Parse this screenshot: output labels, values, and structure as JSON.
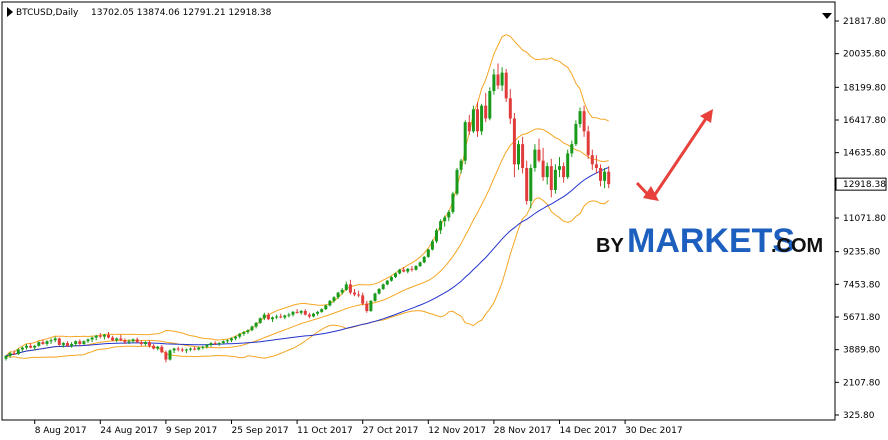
{
  "header": {
    "symbol": "BTCUSD,Daily",
    "ohlc": "13702.05 13874.06 12791.21 12918.38"
  },
  "brand": {
    "by": "BY",
    "main": "MARKETS",
    "com": ".COM"
  },
  "colors": {
    "background": "#ffffff",
    "candle_up": "#1a9a1a",
    "candle_down": "#e03c3c",
    "bollinger": "#f5a623",
    "ma": "#2233cc",
    "arrow": "#e8403a",
    "price_tag_bg": "#ffffff",
    "brand_blue": "#1d5fbf"
  },
  "chart_data": {
    "type": "candlestick",
    "title": "BTCUSD,Daily",
    "y_ticks": [
      "21817.80",
      "20035.80",
      "18199.80",
      "16417.80",
      "14635.80",
      "12918.38",
      "11071.80",
      "9235.80",
      "7453.80",
      "5671.80",
      "3889.80",
      "2107.80",
      "325.80"
    ],
    "x_ticks": [
      "8 Aug 2017",
      "24 Aug 2017",
      "9 Sep 2017",
      "25 Sep 2017",
      "11 Oct 2017",
      "27 Oct 2017",
      "12 Nov 2017",
      "28 Nov 2017",
      "14 Dec 2017",
      "30 Dec 2017"
    ],
    "ylim": [
      325.8,
      22500
    ],
    "current_price": "12918.38",
    "start_date": "2017-08-01",
    "candles": [
      [
        3400,
        3600,
        3300,
        3550
      ],
      [
        3550,
        3750,
        3450,
        3700
      ],
      [
        3700,
        3850,
        3600,
        3650
      ],
      [
        3650,
        3950,
        3600,
        3900
      ],
      [
        3900,
        4050,
        3800,
        4000
      ],
      [
        4000,
        4200,
        3900,
        4100
      ],
      [
        4100,
        4250,
        3950,
        4000
      ],
      [
        4000,
        4150,
        3850,
        4100
      ],
      [
        4100,
        4350,
        4050,
        4300
      ],
      [
        4300,
        4450,
        4150,
        4200
      ],
      [
        4200,
        4400,
        4100,
        4350
      ],
      [
        4350,
        4500,
        4200,
        4400
      ],
      [
        4400,
        4600,
        4300,
        4500
      ],
      [
        4500,
        4550,
        4100,
        4150
      ],
      [
        4150,
        4300,
        4000,
        4250
      ],
      [
        4250,
        4350,
        4050,
        4100
      ],
      [
        4100,
        4300,
        4000,
        4200
      ],
      [
        4200,
        4400,
        4100,
        4350
      ],
      [
        4350,
        4450,
        4150,
        4200
      ],
      [
        4200,
        4400,
        4150,
        4350
      ],
      [
        4350,
        4500,
        4250,
        4450
      ],
      [
        4450,
        4600,
        4300,
        4550
      ],
      [
        4550,
        4700,
        4400,
        4650
      ],
      [
        4650,
        4800,
        4500,
        4600
      ],
      [
        4600,
        4750,
        4450,
        4700
      ],
      [
        4700,
        4850,
        4500,
        4550
      ],
      [
        4550,
        4650,
        4350,
        4400
      ],
      [
        4400,
        4550,
        4300,
        4500
      ],
      [
        4500,
        4700,
        4350,
        4400
      ],
      [
        4400,
        4500,
        4200,
        4300
      ],
      [
        4300,
        4450,
        4200,
        4350
      ],
      [
        4350,
        4500,
        4250,
        4450
      ],
      [
        4450,
        4550,
        4250,
        4300
      ],
      [
        4300,
        4400,
        4100,
        4200
      ],
      [
        4200,
        4350,
        4100,
        4300
      ],
      [
        4300,
        4400,
        4000,
        4100
      ],
      [
        4100,
        4200,
        3900,
        3950
      ],
      [
        3950,
        4100,
        3850,
        4050
      ],
      [
        4050,
        4150,
        3700,
        3750
      ],
      [
        3750,
        3850,
        3200,
        3350
      ],
      [
        3350,
        3900,
        3300,
        3850
      ],
      [
        3850,
        4000,
        3700,
        3950
      ],
      [
        3950,
        4050,
        3800,
        3900
      ],
      [
        3900,
        4000,
        3750,
        3850
      ],
      [
        3850,
        3950,
        3700,
        3900
      ],
      [
        3900,
        4000,
        3800,
        3950
      ],
      [
        3950,
        4050,
        3850,
        3900
      ],
      [
        3900,
        4050,
        3850,
        4000
      ],
      [
        4000,
        4100,
        3900,
        4050
      ],
      [
        4050,
        4200,
        3950,
        4150
      ],
      [
        4150,
        4300,
        4050,
        4250
      ],
      [
        4250,
        4350,
        4150,
        4200
      ],
      [
        4200,
        4300,
        4100,
        4250
      ],
      [
        4250,
        4400,
        4200,
        4350
      ],
      [
        4350,
        4450,
        4250,
        4400
      ],
      [
        4400,
        4550,
        4300,
        4500
      ],
      [
        4500,
        4650,
        4400,
        4600
      ],
      [
        4600,
        4800,
        4500,
        4750
      ],
      [
        4750,
        4900,
        4650,
        4850
      ],
      [
        4850,
        5000,
        4750,
        4950
      ],
      [
        4950,
        5200,
        4900,
        5150
      ],
      [
        5150,
        5400,
        5050,
        5350
      ],
      [
        5350,
        5650,
        5300,
        5600
      ],
      [
        5600,
        5900,
        5500,
        5800
      ],
      [
        5800,
        5900,
        5500,
        5550
      ],
      [
        5550,
        5700,
        5400,
        5650
      ],
      [
        5650,
        5800,
        5550,
        5700
      ],
      [
        5700,
        5850,
        5600,
        5650
      ],
      [
        5650,
        5800,
        5550,
        5750
      ],
      [
        5750,
        5900,
        5650,
        5800
      ],
      [
        5800,
        6000,
        5700,
        5950
      ],
      [
        5950,
        6100,
        5850,
        5900
      ],
      [
        5900,
        6050,
        5800,
        6000
      ],
      [
        6000,
        6100,
        5750,
        5800
      ],
      [
        5800,
        5900,
        5600,
        5700
      ],
      [
        5700,
        5900,
        5650,
        5850
      ],
      [
        5850,
        6000,
        5750,
        5950
      ],
      [
        5950,
        6150,
        5900,
        6100
      ],
      [
        6100,
        6350,
        6050,
        6300
      ],
      [
        6300,
        6600,
        6250,
        6550
      ],
      [
        6550,
        6800,
        6450,
        6750
      ],
      [
        6750,
        7050,
        6650,
        7000
      ],
      [
        7000,
        7250,
        6900,
        7150
      ],
      [
        7150,
        7600,
        7100,
        7450
      ],
      [
        7450,
        7700,
        6900,
        7000
      ],
      [
        7000,
        7200,
        6800,
        6900
      ],
      [
        6900,
        7100,
        6750,
        6850
      ],
      [
        6850,
        7000,
        6300,
        6400
      ],
      [
        6400,
        6550,
        5900,
        6000
      ],
      [
        6000,
        6600,
        5950,
        6550
      ],
      [
        6550,
        7000,
        6500,
        6950
      ],
      [
        6950,
        7250,
        6900,
        7200
      ],
      [
        7200,
        7500,
        7150,
        7450
      ],
      [
        7450,
        7700,
        7400,
        7650
      ],
      [
        7650,
        7900,
        7600,
        7850
      ],
      [
        7850,
        8100,
        7800,
        8050
      ],
      [
        8050,
        8300,
        8000,
        8250
      ],
      [
        8250,
        8400,
        8100,
        8150
      ],
      [
        8150,
        8350,
        8050,
        8300
      ],
      [
        8300,
        8450,
        8150,
        8250
      ],
      [
        8250,
        8500,
        8200,
        8450
      ],
      [
        8450,
        8700,
        8400,
        8650
      ],
      [
        8650,
        9000,
        8600,
        8950
      ],
      [
        8950,
        9400,
        8900,
        9350
      ],
      [
        9350,
        9900,
        9300,
        9800
      ],
      [
        9800,
        10500,
        9700,
        10400
      ],
      [
        10400,
        11000,
        10200,
        10900
      ],
      [
        10900,
        11200,
        10600,
        11100
      ],
      [
        11100,
        11500,
        10900,
        11400
      ],
      [
        11400,
        12500,
        11300,
        12400
      ],
      [
        12400,
        13800,
        12300,
        13700
      ],
      [
        13700,
        14300,
        13500,
        14200
      ],
      [
        14200,
        16400,
        14000,
        16300
      ],
      [
        16300,
        16700,
        15600,
        15800
      ],
      [
        15800,
        17200,
        15700,
        17000
      ],
      [
        17000,
        17400,
        15500,
        15800
      ],
      [
        15800,
        17300,
        15600,
        17200
      ],
      [
        17200,
        17900,
        16300,
        16500
      ],
      [
        16500,
        18200,
        16400,
        18000
      ],
      [
        18000,
        19200,
        17800,
        18900
      ],
      [
        18900,
        19500,
        18100,
        18300
      ],
      [
        18300,
        19300,
        18000,
        19000
      ],
      [
        19000,
        19200,
        17400,
        17600
      ],
      [
        17600,
        18100,
        16200,
        16500
      ],
      [
        16500,
        16800,
        13300,
        14000
      ],
      [
        14000,
        15300,
        13700,
        15100
      ],
      [
        15100,
        15500,
        13500,
        13800
      ],
      [
        13800,
        14200,
        11800,
        12000
      ],
      [
        12000,
        14000,
        11600,
        13800
      ],
      [
        13800,
        15100,
        13600,
        14800
      ],
      [
        14800,
        15400,
        14100,
        14200
      ],
      [
        14200,
        14900,
        13100,
        13300
      ],
      [
        13300,
        14100,
        12900,
        13900
      ],
      [
        13900,
        14300,
        12200,
        12600
      ],
      [
        12600,
        14000,
        12400,
        13700
      ],
      [
        13700,
        14400,
        13300,
        13900
      ],
      [
        13900,
        14100,
        13000,
        13300
      ],
      [
        13300,
        14800,
        13200,
        14600
      ],
      [
        14600,
        15300,
        14400,
        15100
      ],
      [
        15100,
        16400,
        15000,
        16200
      ],
      [
        16200,
        17100,
        16000,
        16900
      ],
      [
        16900,
        17200,
        15500,
        15800
      ],
      [
        15800,
        16100,
        14300,
        14500
      ],
      [
        14500,
        14800,
        13700,
        14000
      ],
      [
        14000,
        14500,
        13500,
        13800
      ],
      [
        13800,
        14000,
        12800,
        13100
      ],
      [
        13100,
        13800,
        12700,
        13600
      ],
      [
        13600,
        13900,
        12700,
        12918.38
      ]
    ]
  }
}
